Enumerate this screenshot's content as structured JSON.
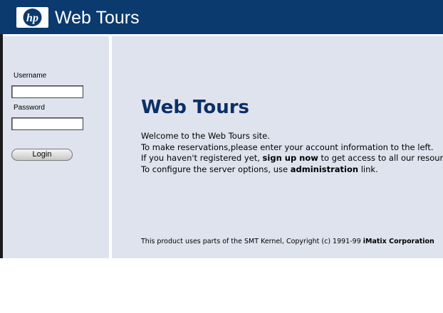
{
  "header": {
    "logo_text": "hp",
    "brand": "Web Tours"
  },
  "sidebar": {
    "username_label": "Username",
    "username_value": "",
    "password_label": "Password",
    "password_value": "",
    "login_label": "Login"
  },
  "main": {
    "title": "Web Tours",
    "line1": "Welcome to the Web Tours site.",
    "line2": "To make reservations,please enter your account information to the left.",
    "line3_prefix": "If you haven't registered yet, ",
    "line3_link": "sign up now",
    "line3_suffix": " to get access to all our resources.",
    "line4_prefix": "To configure the server options, use ",
    "line4_link": "administration",
    "line4_suffix": " link."
  },
  "footer": {
    "copyright_text": "This product uses parts of the SMT Kernel, Copyright (c) 1991-99 ",
    "copyright_org": "iMatix Corporation"
  },
  "colors": {
    "header_bg": "#0b3a6e",
    "panel_bg": "#dfe3ee",
    "title": "#0b2f66"
  }
}
